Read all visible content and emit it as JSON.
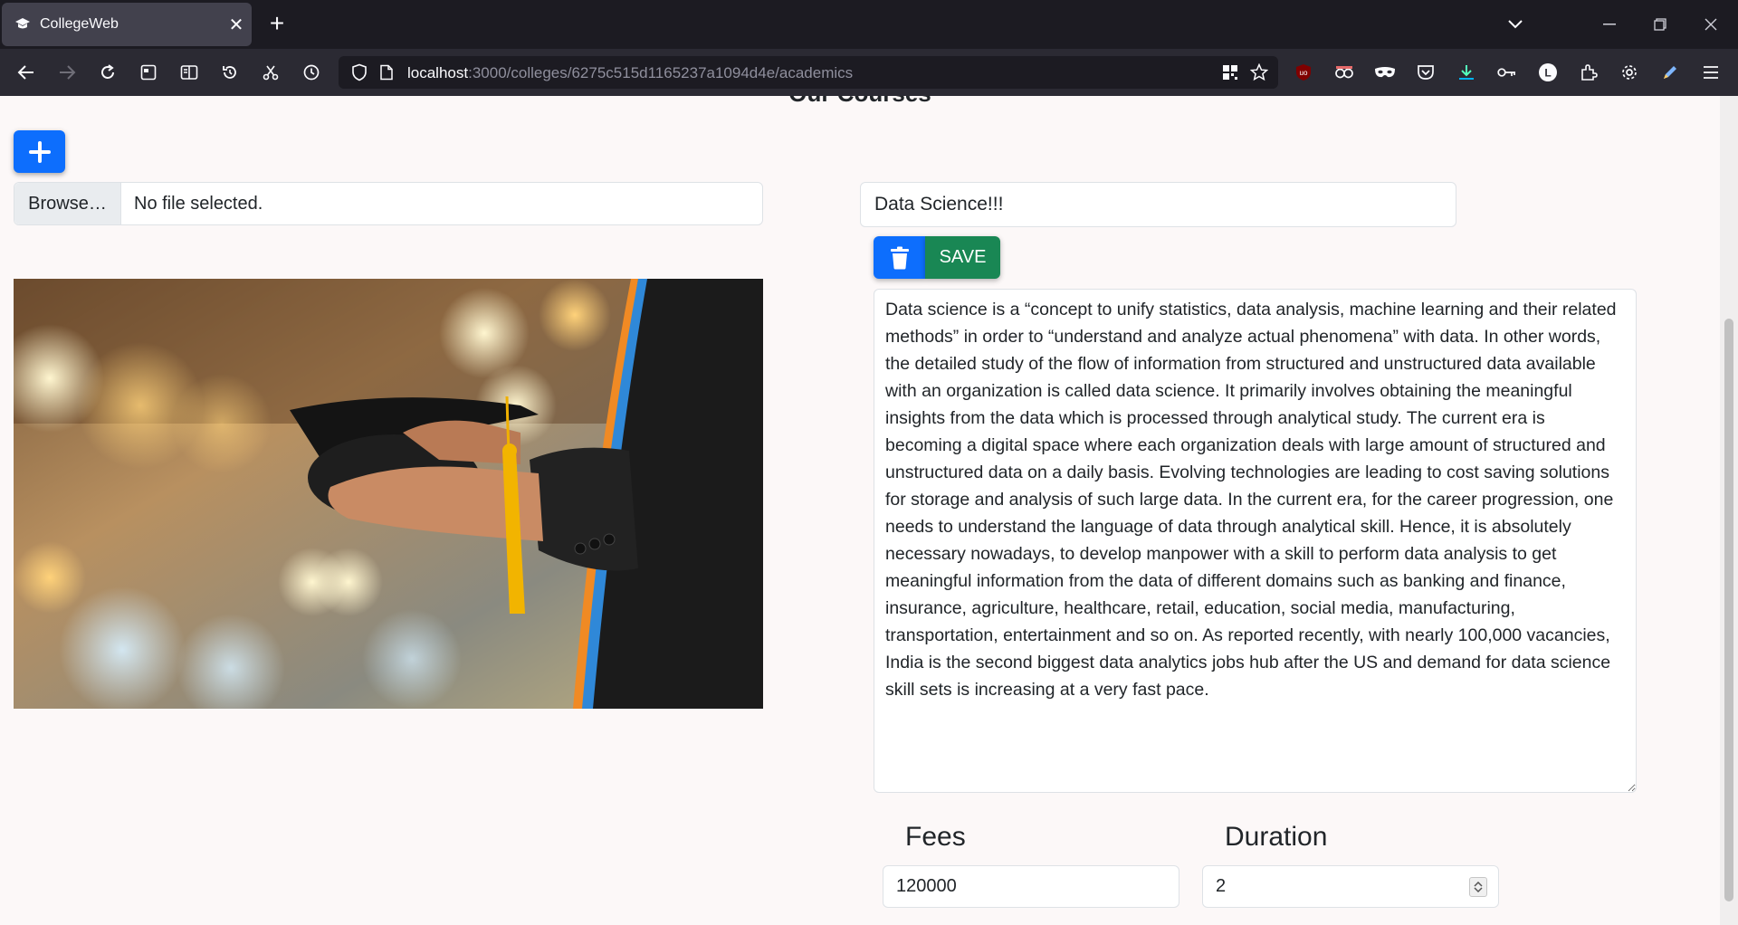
{
  "browser": {
    "tab_title": "CollegeWeb",
    "url_host": "localhost",
    "url_rest": ":3000/colleges/6275c515d1165237a1094d4e/academics"
  },
  "page": {
    "section_heading": "Our Courses",
    "file_input": {
      "browse_label": "Browse…",
      "status_text": "No file selected."
    },
    "course": {
      "title": "Data Science!!!",
      "save_label": "SAVE",
      "description": "Data science is a “concept to unify statistics, data analysis, machine learning and their related methods” in order to “understand and analyze actual phenomena” with data. In other words, the detailed study of the flow of information from structured and unstructured data available with an organization is called data science. It primarily involves obtaining the meaningful insights from the data which is processed through analytical study. The current era is becoming a digital space where each organization deals with large amount of structured and unstructured data on a daily basis. Evolving technologies are leading to cost saving solutions for storage and analysis of such large data. In the current era, for the career progression, one needs to understand the language of data through analytical skill. Hence, it is absolutely necessary nowadays, to develop manpower with a skill to perform data analysis to get meaningful information from the data of different domains such as banking and finance, insurance, agriculture, healthcare, retail, education, social media, manufacturing, transportation, entertainment and so on. As reported recently, with nearly 100,000 vacancies, India is the second biggest data analytics jobs hub after the US and demand for data science skill sets is increasing at a very fast pace.",
      "fees_label": "Fees",
      "fees_value": "120000",
      "duration_label": "Duration",
      "duration_value": "2"
    }
  },
  "colors": {
    "primary": "#0d6efd",
    "success": "#198754",
    "page_bg": "#fcf8f8",
    "chrome_bg": "#1c1b22",
    "toolbar_bg": "#2b2a33"
  },
  "icons": [
    "back-icon",
    "forward-icon",
    "reload-icon",
    "bookmark-sidebar-icon",
    "reader-icon",
    "history-icon",
    "screenshot-icon",
    "clock-icon",
    "shield-icon",
    "page-icon",
    "qr-icon",
    "star-icon",
    "ublock-icon",
    "extension-icon",
    "mask-icon",
    "pocket-icon",
    "download-icon",
    "key-icon",
    "account-icon",
    "extensions-icon",
    "settings-icon",
    "pen-icon",
    "menu-icon",
    "plus-icon",
    "trash-icon"
  ]
}
